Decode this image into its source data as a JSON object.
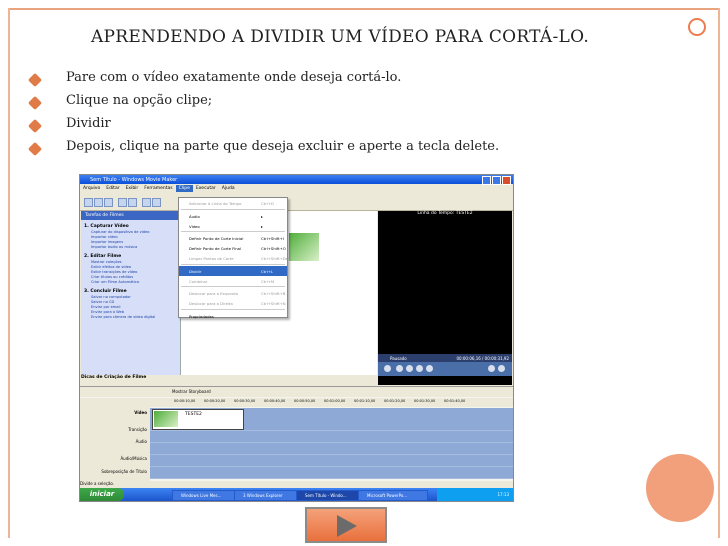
{
  "slide": {
    "title": "APRENDENDO A DIVIDIR UM VÍDEO PARA CORTÁ-LO.",
    "bullets": [
      "Pare com o vídeo exatamente onde deseja cortá-lo.",
      "Clique na opção clipe;",
      "Dividir",
      "Depois, clique na parte que deseja excluir e aperte a tecla delete."
    ]
  },
  "app": {
    "window_title": "Sem Título - Windows Movie Maker",
    "menu": [
      "Arquivo",
      "Editar",
      "Exibir",
      "Ferramentas",
      "Clipe",
      "Executar",
      "Ajuda"
    ],
    "active_menu": "Clipe"
  },
  "tasks": {
    "header": "Tarefas de Filmes",
    "sections": [
      {
        "title": "1. Capturar Vídeo",
        "links": [
          "Capturar do dispositivo de vídeo",
          "Importar vídeo",
          "Importar imagens",
          "Importar áudio ou música"
        ]
      },
      {
        "title": "2. Editar Filme",
        "links": [
          "Mostrar coleções",
          "Exibir efeitos de vídeo",
          "Exibir transições de vídeo",
          "Criar títulos ou créditos",
          "Criar um Filme Automático"
        ]
      },
      {
        "title": "3. Concluir Filme",
        "links": [
          "Salvar no computador",
          "Salvar no CD",
          "Enviar por email",
          "Enviar para a Web",
          "Enviar para câmera de vídeo digital"
        ]
      }
    ],
    "tips": "Dicas de Criação de Filme"
  },
  "context_menu": {
    "items": [
      {
        "label": "Adicionar à Linha do Tempo",
        "key": "Ctrl+D",
        "state": "disabled"
      },
      {
        "label": "Áudio",
        "key": "▸",
        "state": "normal"
      },
      {
        "label": "Vídeo",
        "key": "▸",
        "state": "normal"
      },
      {
        "label": "Definir Ponto de Corte Inicial",
        "key": "Ctrl+Shift+I",
        "state": "normal"
      },
      {
        "label": "Definir Ponto de Corte Final",
        "key": "Ctrl+Shift+O",
        "state": "normal"
      },
      {
        "label": "Limpar Pontos de Corte",
        "key": "Ctrl+Shift+Del",
        "state": "disabled"
      },
      {
        "label": "Dividir",
        "key": "Ctrl+L",
        "state": "highlighted"
      },
      {
        "label": "Combinar",
        "key": "Ctrl+M",
        "state": "disabled"
      },
      {
        "label": "Deslocar para a Esquerda",
        "key": "Ctrl+Shift+B",
        "state": "disabled"
      },
      {
        "label": "Deslocar para a Direita",
        "key": "Ctrl+Shift+N",
        "state": "disabled"
      },
      {
        "label": "Propriedades",
        "key": "",
        "state": "normal"
      }
    ]
  },
  "preview": {
    "header": "Linha do Tempo: TESTE2",
    "status": "Pausado",
    "time": "00:00:06,16 / 00:00:31,92"
  },
  "timeline": {
    "toolbar_label": "Mostrar Storyboard",
    "ruler": [
      "00:00:10,00",
      "00:00:20,00",
      "00:00:30,00",
      "00:00:40,00",
      "00:00:50,00",
      "00:01:00,00",
      "00:01:10,00",
      "00:01:20,00",
      "00:01:30,00",
      "00:01:40,00"
    ],
    "tracks": [
      "Vídeo",
      "Transição",
      "Áudio",
      "Áudio/Música",
      "Sobreposição de Título"
    ],
    "clip_label": "TESTE2"
  },
  "status_bar": "Divide a seleção.",
  "taskbar": {
    "start": "iniciar",
    "items": [
      "Windows Live Mes...",
      "3 Windows Explorer",
      "Sem Título - Windo...",
      "Microsoft PowerPo..."
    ],
    "clock": "17:13"
  },
  "colors": {
    "accent": "#e07a46",
    "frame": "#eeb594",
    "xp_blue": "#0a4fd8"
  },
  "icons": {
    "play_button": "play-triangle-icon"
  }
}
